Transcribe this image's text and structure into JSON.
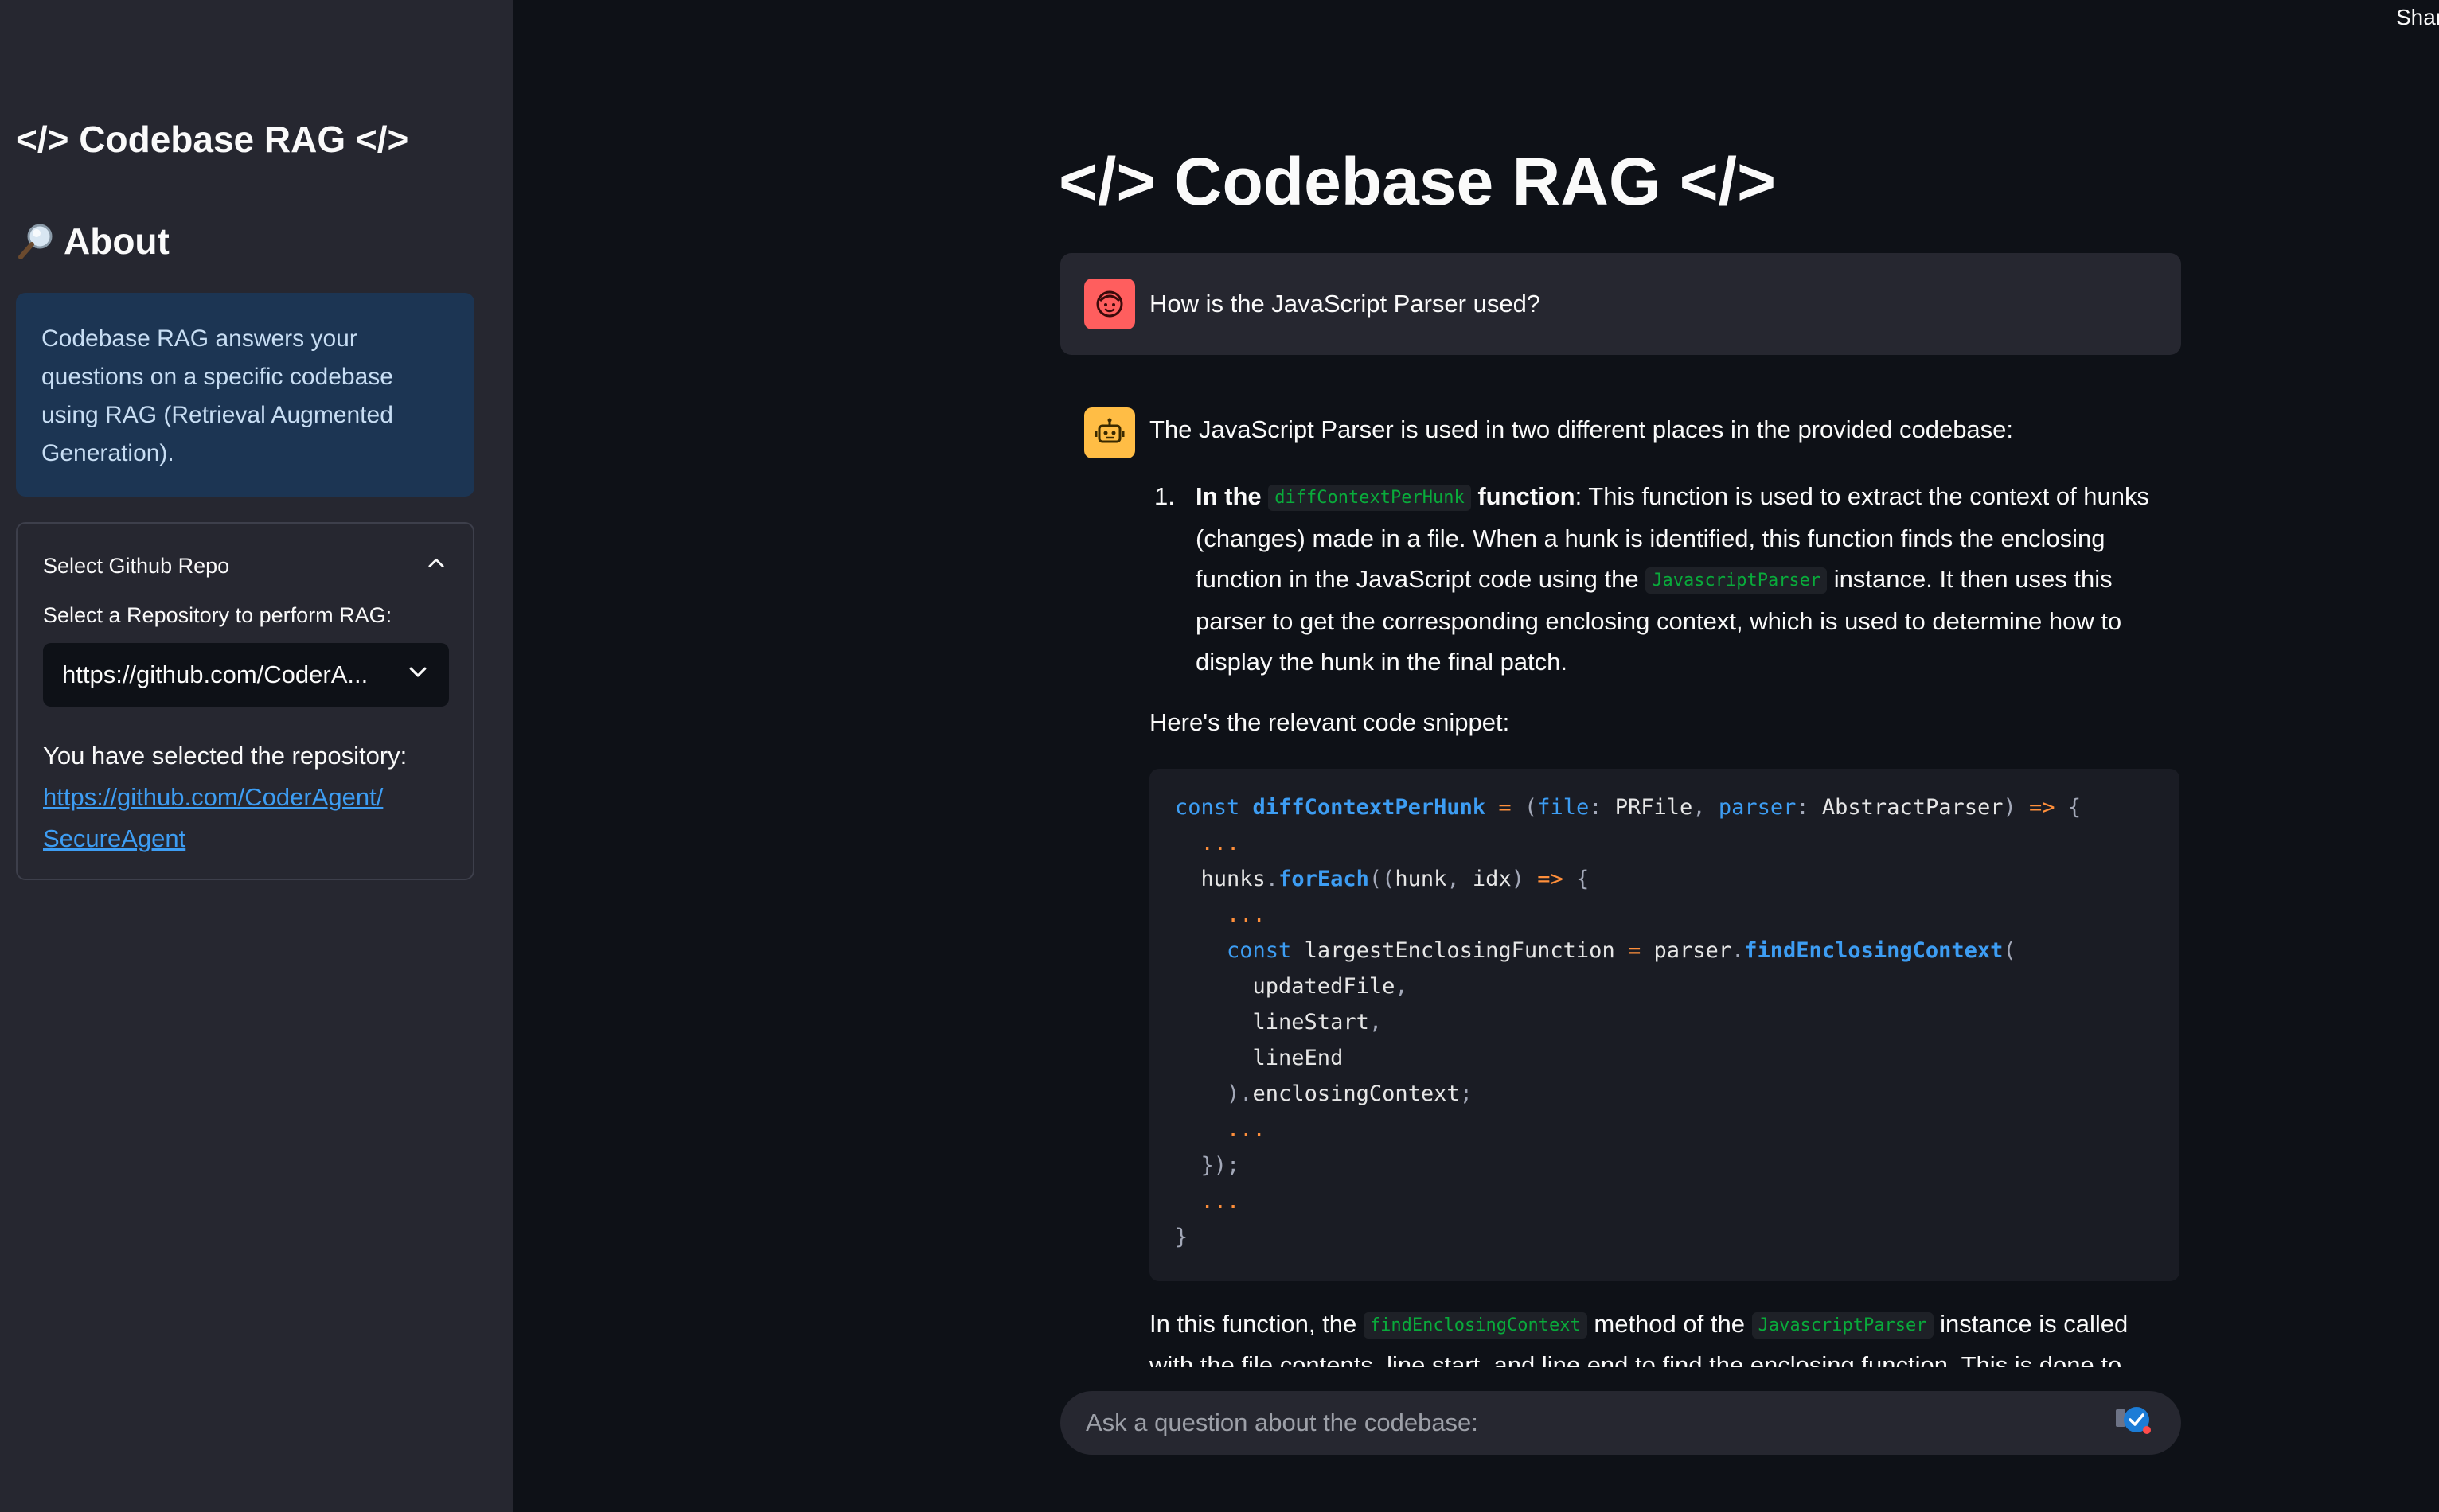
{
  "sidebar": {
    "title": "</> Codebase RAG </>",
    "about_heading": "About",
    "info_text": "Codebase RAG answers your questions on a specific codebase using RAG (Retrieval Augmented Generation).",
    "expander": {
      "header": "Select Github Repo",
      "select_label": "Select a Repository to perform RAG:",
      "selected_value": "https://github.com/CoderA...",
      "selected_prefix": "You have selected the repository:",
      "link_line1": "https://github.com/CoderAgent/",
      "link_line2": "SecureAgent"
    }
  },
  "header": {
    "share": "Share"
  },
  "main": {
    "title": "</> Codebase RAG </>",
    "user_question": "How is the JavaScript Parser used?",
    "answer": {
      "intro": "The JavaScript Parser is used in two different places in the provided codebase:",
      "list_num": "1.",
      "item_in_the": "In the",
      "item_code": "diffContextPerHunk",
      "item_function": "function",
      "item_text_a": ": This function is used to extract the context of hunks (changes) made in a file. When a hunk is identified, this function finds the enclosing function in the JavaScript code using the",
      "item_code2": "JavascriptParser",
      "item_text_b": "instance. It then uses this parser to get the corresponding enclosing context, which is used to determine how to display the hunk in the final patch.",
      "snippet_label": "Here's the relevant code snippet:",
      "outro_a": "In this function, the",
      "outro_code1": "findEnclosingContext",
      "outro_b": "method of the",
      "outro_code2": "JavascriptParser",
      "outro_c": "instance is called",
      "outro_line2": "with the file contents, line start, and line end to find the enclosing function. This is done to"
    },
    "chat_placeholder": "Ask a question about the codebase:"
  },
  "icons": {
    "about": "magnifying-glass-icon",
    "user_avatar": "user-face-icon",
    "bot_avatar": "robot-icon",
    "send": "send-icon"
  },
  "colors": {
    "background": "#0e1117",
    "sidebar": "#262730",
    "info_box": "#1c3553",
    "link": "#3d9df3",
    "inline_code": "#09ab3b",
    "user_avatar": "#ff5e5e",
    "bot_avatar": "#ffbd45"
  }
}
